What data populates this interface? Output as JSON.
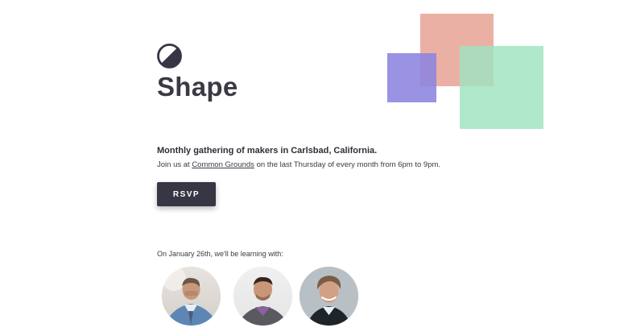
{
  "hero": {
    "title": "Shape"
  },
  "intro": {
    "tagline": "Monthly gathering of makers in Carlsbad, California.",
    "details_prefix": "Join us at ",
    "venue_link": "Common Grounds",
    "details_suffix": " on the last Thursday of every month from 6pm to 9pm."
  },
  "cta": {
    "rsvp_label": "RSVP"
  },
  "event": {
    "intro": "On January 26th, we'll be learning with:"
  },
  "speakers": [
    {
      "name": ""
    },
    {
      "name": ""
    },
    {
      "name": ""
    }
  ],
  "colors": {
    "text": "#2f2f37",
    "button_bg": "#363645",
    "square_red": "#e9a99c",
    "square_blue": "#8f86df",
    "square_green": "#9fe3bf"
  },
  "icons": {
    "logo": "shape-logo-icon"
  }
}
